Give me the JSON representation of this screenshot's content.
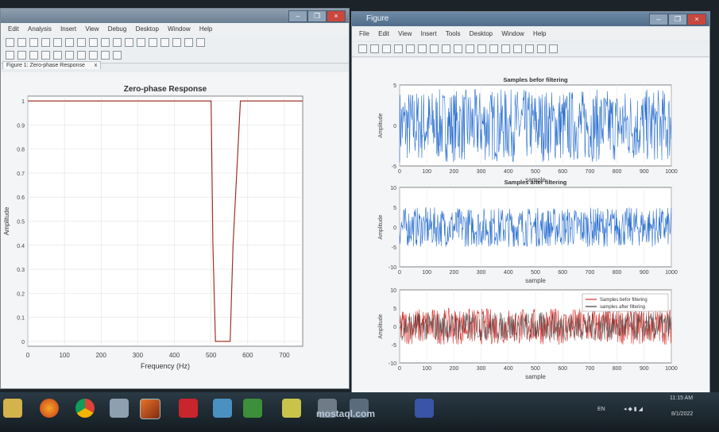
{
  "left_window": {
    "menu": [
      "Edit",
      "Analysis",
      "Insert",
      "View",
      "Debug",
      "Desktop",
      "Window",
      "Help"
    ],
    "doc_tab": "Figure 1: Zero-phase Response",
    "doc_tab_close": "x",
    "chart_title": "Zero-phase Response",
    "xlabel": "Frequency (Hz)",
    "ylabel": "Amplitude",
    "xticks": [
      "0",
      "100",
      "200",
      "300",
      "400",
      "500",
      "600",
      "700"
    ],
    "yticks": [
      "0",
      "0.1",
      "0.2",
      "0.3",
      "0.4",
      "0.5",
      "0.6",
      "0.7",
      "0.8",
      "0.9",
      "1"
    ]
  },
  "right_window": {
    "title": "Figure",
    "menu": [
      "File",
      "Edit",
      "View",
      "Insert",
      "Tools",
      "Desktop",
      "Window",
      "Help"
    ]
  },
  "charts": [
    {
      "title": "Samples befor filtering",
      "xlabel": "sample",
      "ylabel": "Amplitude",
      "yticks": [
        "5",
        "0",
        "-5"
      ],
      "xticks": [
        "0",
        "100",
        "200",
        "300",
        "400",
        "500",
        "600",
        "700",
        "800",
        "900",
        "1000"
      ]
    },
    {
      "title": "Samples after filtering",
      "xlabel": "sample",
      "ylabel": "Amplitude",
      "yticks": [
        "10",
        "5",
        "0",
        "-5",
        "-10"
      ],
      "xticks": [
        "0",
        "100",
        "200",
        "300",
        "400",
        "500",
        "600",
        "700",
        "800",
        "900",
        "1000"
      ]
    },
    {
      "title": "",
      "xlabel": "sample",
      "ylabel": "Amplitude",
      "yticks": [
        "10",
        "5",
        "0",
        "-5",
        "-10"
      ],
      "xticks": [
        "0",
        "100",
        "200",
        "300",
        "400",
        "500",
        "600",
        "700",
        "800",
        "900",
        "1000"
      ],
      "legend": [
        "Samples befor filtering",
        "samples after filtering"
      ]
    }
  ],
  "chart_data": [
    {
      "type": "line",
      "title": "Zero-phase Response",
      "xlabel": "Frequency (Hz)",
      "ylabel": "Amplitude",
      "xlim": [
        0,
        750
      ],
      "ylim": [
        -0.02,
        1.02
      ],
      "series": [
        {
          "color": "#c0392b",
          "x": [
            0,
            500,
            505,
            512,
            545,
            552,
            560,
            580,
            700,
            750
          ],
          "y": [
            1.0,
            1.0,
            0.4,
            0.0,
            0.0,
            0.0,
            0.4,
            1.0,
            1.0,
            1.0
          ]
        }
      ],
      "grid": true
    },
    {
      "type": "line",
      "title": "Samples befor filtering",
      "xlabel": "sample",
      "ylabel": "Amplitude",
      "xlim": [
        0,
        1000
      ],
      "ylim": [
        -5,
        5
      ],
      "series": [
        {
          "color": "#2a6fd0",
          "amplitude": 4.5
        }
      ],
      "grid": true
    },
    {
      "type": "line",
      "title": "Samples after filtering",
      "xlabel": "sample",
      "ylabel": "Amplitude",
      "xlim": [
        0,
        1000
      ],
      "ylim": [
        -10,
        10
      ],
      "series": [
        {
          "color": "#2a6fd0",
          "amplitude": 5
        }
      ],
      "grid": true
    },
    {
      "type": "line",
      "title": "",
      "xlabel": "sample",
      "ylabel": "Amplitude",
      "xlim": [
        0,
        1000
      ],
      "ylim": [
        -10,
        10
      ],
      "legend_position": "top-right",
      "series": [
        {
          "name": "Samples befor filtering",
          "color": "#d6312b",
          "amplitude": 5
        },
        {
          "name": "samples after filtering",
          "color": "#3a3a3a",
          "amplitude": 4
        }
      ],
      "grid": true
    }
  ],
  "taskbar": {
    "tray_lang": "EN",
    "time": "11:15 AM",
    "date": "8/1/2022",
    "watermark": "mostaql.com"
  },
  "colors": {
    "red": "#c0392b",
    "blue": "#2a6fd0"
  }
}
